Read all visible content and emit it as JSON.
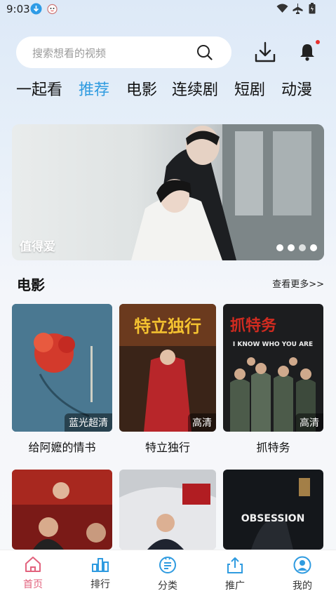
{
  "status_bar": {
    "time": "9:03"
  },
  "search": {
    "placeholder": "搜索想看的视频"
  },
  "tabs": [
    "一起看",
    "推荐",
    "电影",
    "连续剧",
    "短剧",
    "动漫"
  ],
  "active_tab": "推荐",
  "banner": {
    "title": "值得爱",
    "slide_count": 4
  },
  "section": {
    "title": "电影",
    "more": "查看更多>>"
  },
  "movies": [
    {
      "title": "给阿嬷的情书",
      "badge": "蓝光超清"
    },
    {
      "title": "特立独行",
      "badge": "高清"
    },
    {
      "title": "抓特务",
      "badge": "高清"
    },
    {
      "title": "",
      "badge": ""
    },
    {
      "title": "",
      "badge": ""
    },
    {
      "title": "",
      "badge": ""
    }
  ],
  "poster_text": {
    "p3_title": "抓特务",
    "p3_sub": "I KNOW WHO YOU ARE",
    "p2_title": "特立独行",
    "p6_title": "OBSESSION"
  },
  "tabbar": [
    {
      "label": "首页",
      "icon": "home-icon"
    },
    {
      "label": "排行",
      "icon": "ranking-icon"
    },
    {
      "label": "分类",
      "icon": "category-icon"
    },
    {
      "label": "推广",
      "icon": "share-icon"
    },
    {
      "label": "我的",
      "icon": "profile-icon"
    }
  ],
  "colors": {
    "accent": "#2f9be0",
    "home_active": "#e2627d",
    "notify_dot": "#e8322e"
  }
}
